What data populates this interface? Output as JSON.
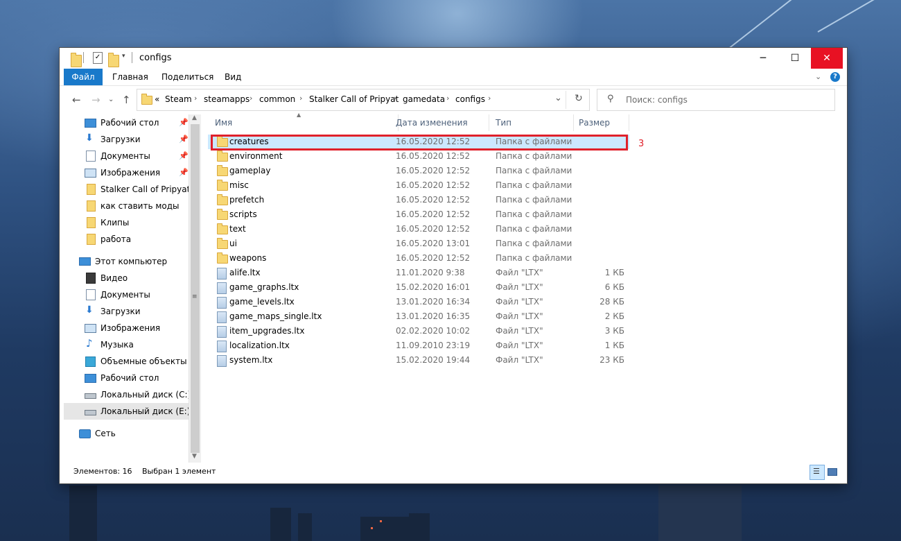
{
  "window": {
    "title": "configs",
    "minimize": "─",
    "maximize": "☐",
    "close": "✕"
  },
  "ribbon": {
    "tabs": [
      "Файл",
      "Главная",
      "Поделиться",
      "Вид"
    ],
    "help": "?"
  },
  "address": {
    "prefix": "«",
    "crumbs": [
      "Steam",
      "steamapps",
      "common",
      "Stalker Call of Pripyat",
      "gamedata",
      "configs"
    ]
  },
  "search": {
    "placeholder": "Поиск: configs"
  },
  "nav": {
    "quick": [
      {
        "label": "Рабочий стол",
        "icon": "desktop-icon",
        "pinned": true
      },
      {
        "label": "Загрузки",
        "icon": "downloads-icon",
        "pinned": true
      },
      {
        "label": "Документы",
        "icon": "documents-icon",
        "pinned": true
      },
      {
        "label": "Изображения",
        "icon": "pictures-icon",
        "pinned": true
      },
      {
        "label": "Stalker Call of Pripyat",
        "icon": "folder-icon",
        "pinned": false
      },
      {
        "label": "как ставить моды",
        "icon": "folder-icon",
        "pinned": false
      },
      {
        "label": "Клипы",
        "icon": "folder-icon",
        "pinned": false
      },
      {
        "label": "работа",
        "icon": "folder-icon",
        "pinned": false
      }
    ],
    "this_pc": "Этот компьютер",
    "pc_items": [
      {
        "label": "Видео",
        "icon": "video-icon"
      },
      {
        "label": "Документы",
        "icon": "documents-icon"
      },
      {
        "label": "Загрузки",
        "icon": "downloads-icon"
      },
      {
        "label": "Изображения",
        "icon": "pictures-icon"
      },
      {
        "label": "Музыка",
        "icon": "music-icon"
      },
      {
        "label": "Объемные объекты",
        "icon": "3d-objects-icon"
      },
      {
        "label": "Рабочий стол",
        "icon": "desktop-icon"
      },
      {
        "label": "Локальный диск (C:)",
        "icon": "drive-icon"
      },
      {
        "label": "Локальный диск (E:)",
        "icon": "drive-icon"
      }
    ],
    "network": "Сеть"
  },
  "columns": {
    "name": "Имя",
    "date": "Дата изменения",
    "type": "Тип",
    "size": "Размер"
  },
  "files": [
    {
      "name": "creatures",
      "date": "16.05.2020 12:52",
      "type": "Папка с файлами",
      "size": "",
      "kind": "folder"
    },
    {
      "name": "environment",
      "date": "16.05.2020 12:52",
      "type": "Папка с файлами",
      "size": "",
      "kind": "folder"
    },
    {
      "name": "gameplay",
      "date": "16.05.2020 12:52",
      "type": "Папка с файлами",
      "size": "",
      "kind": "folder"
    },
    {
      "name": "misc",
      "date": "16.05.2020 12:52",
      "type": "Папка с файлами",
      "size": "",
      "kind": "folder"
    },
    {
      "name": "prefetch",
      "date": "16.05.2020 12:52",
      "type": "Папка с файлами",
      "size": "",
      "kind": "folder"
    },
    {
      "name": "scripts",
      "date": "16.05.2020 12:52",
      "type": "Папка с файлами",
      "size": "",
      "kind": "folder"
    },
    {
      "name": "text",
      "date": "16.05.2020 12:52",
      "type": "Папка с файлами",
      "size": "",
      "kind": "folder"
    },
    {
      "name": "ui",
      "date": "16.05.2020 13:01",
      "type": "Папка с файлами",
      "size": "",
      "kind": "folder"
    },
    {
      "name": "weapons",
      "date": "16.05.2020 12:52",
      "type": "Папка с файлами",
      "size": "",
      "kind": "folder"
    },
    {
      "name": "alife.ltx",
      "date": "11.01.2020 9:38",
      "type": "Файл \"LTX\"",
      "size": "1 КБ",
      "kind": "file"
    },
    {
      "name": "game_graphs.ltx",
      "date": "15.02.2020 16:01",
      "type": "Файл \"LTX\"",
      "size": "6 КБ",
      "kind": "file"
    },
    {
      "name": "game_levels.ltx",
      "date": "13.01.2020 16:34",
      "type": "Файл \"LTX\"",
      "size": "28 КБ",
      "kind": "file"
    },
    {
      "name": "game_maps_single.ltx",
      "date": "13.01.2020 16:35",
      "type": "Файл \"LTX\"",
      "size": "2 КБ",
      "kind": "file"
    },
    {
      "name": "item_upgrades.ltx",
      "date": "02.02.2020 10:02",
      "type": "Файл \"LTX\"",
      "size": "3 КБ",
      "kind": "file"
    },
    {
      "name": "localization.ltx",
      "date": "11.09.2010 23:19",
      "type": "Файл \"LTX\"",
      "size": "1 КБ",
      "kind": "file"
    },
    {
      "name": "system.ltx",
      "date": "15.02.2020 19:44",
      "type": "Файл \"LTX\"",
      "size": "23 КБ",
      "kind": "file"
    }
  ],
  "annotation": {
    "number": "3"
  },
  "status": {
    "count": "Элементов: 16",
    "selected": "Выбран 1 элемент"
  }
}
